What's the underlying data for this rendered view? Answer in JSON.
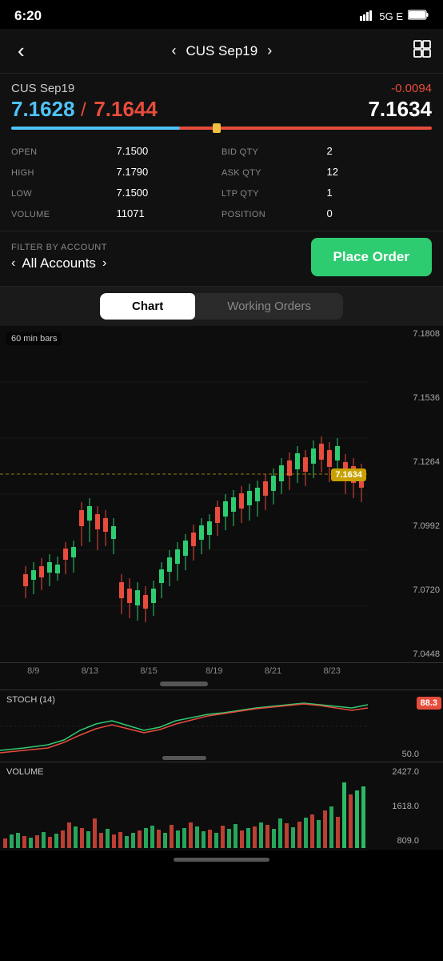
{
  "statusBar": {
    "time": "6:20",
    "signal": "5G E",
    "battery": "100"
  },
  "topNav": {
    "backLabel": "‹",
    "prevLabel": "‹",
    "title": "CUS Sep19",
    "nextLabel": "›",
    "gridIcon": "⊞"
  },
  "priceHeader": {
    "instrumentName": "CUS Sep19",
    "priceChange": "-0.0094",
    "bidPrice": "7.1628",
    "separator": " / ",
    "askPrice": "7.1644",
    "ltpPrice": "7.1634"
  },
  "marketData": {
    "rows": [
      {
        "label": "OPEN",
        "value": "7.1500",
        "label2": "BID QTY",
        "value2": "2"
      },
      {
        "label": "HIGH",
        "value": "7.1790",
        "label2": "ASK QTY",
        "value2": "12"
      },
      {
        "label": "LOW",
        "value": "7.1500",
        "label2": "LTP QTY",
        "value2": "1"
      },
      {
        "label": "VOLUME",
        "value": "11071",
        "label2": "POSITION",
        "value2": "0"
      }
    ]
  },
  "filterRow": {
    "filterLabel": "FILTER BY ACCOUNT",
    "prevChevron": "‹",
    "accountName": "All Accounts",
    "nextChevron": "›",
    "placeOrderLabel": "Place Order"
  },
  "chartTabs": {
    "tab1": "Chart",
    "tab2": "Working Orders"
  },
  "chart": {
    "barLabel": "60 min bars",
    "priceBadge": "7.1634",
    "yAxisLabels": [
      "7.1808",
      "7.1536",
      "7.1264",
      "7.0992",
      "7.0720",
      "7.0448"
    ],
    "xAxisLabels": [
      "8/9",
      "8/13",
      "8/15",
      "8/19",
      "8/21",
      "8/23"
    ]
  },
  "stochPanel": {
    "label": "STOCH (14)",
    "badge": "88.3",
    "midValue": "50.0"
  },
  "volumePanel": {
    "label": "VOLUME",
    "yLabels": [
      "2427.0",
      "1618.0",
      "809.0"
    ]
  },
  "colors": {
    "accent_green": "#2ecc71",
    "accent_red": "#e74c3c",
    "accent_blue": "#4fc3f7",
    "bg_dark": "#111",
    "chart_bg": "#0d0d0d"
  }
}
